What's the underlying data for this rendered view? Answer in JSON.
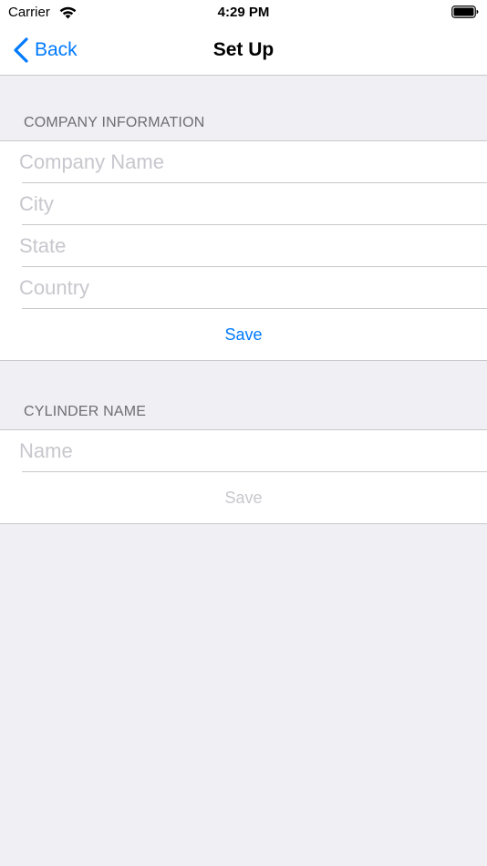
{
  "status_bar": {
    "carrier": "Carrier",
    "time": "4:29 PM",
    "icons": [
      "wifi-icon",
      "battery-icon"
    ]
  },
  "nav": {
    "back_label": "Back",
    "title": "Set Up",
    "icons": [
      "chevron-left-icon"
    ]
  },
  "company_section": {
    "header": "COMPANY INFORMATION",
    "fields": [
      {
        "placeholder": "Company Name",
        "value": ""
      },
      {
        "placeholder": "City",
        "value": ""
      },
      {
        "placeholder": "State",
        "value": ""
      },
      {
        "placeholder": "Country",
        "value": ""
      }
    ],
    "save_label": "Save"
  },
  "cylinder_section": {
    "header": "CYLINDER NAME",
    "fields": [
      {
        "placeholder": "Name",
        "value": ""
      }
    ],
    "save_label": "Save"
  },
  "colors": {
    "accent": "#007aff",
    "background": "#efeff4",
    "placeholder": "#c7c7cd",
    "section_header": "#6d6d72",
    "separator": "#c8c7cc"
  }
}
